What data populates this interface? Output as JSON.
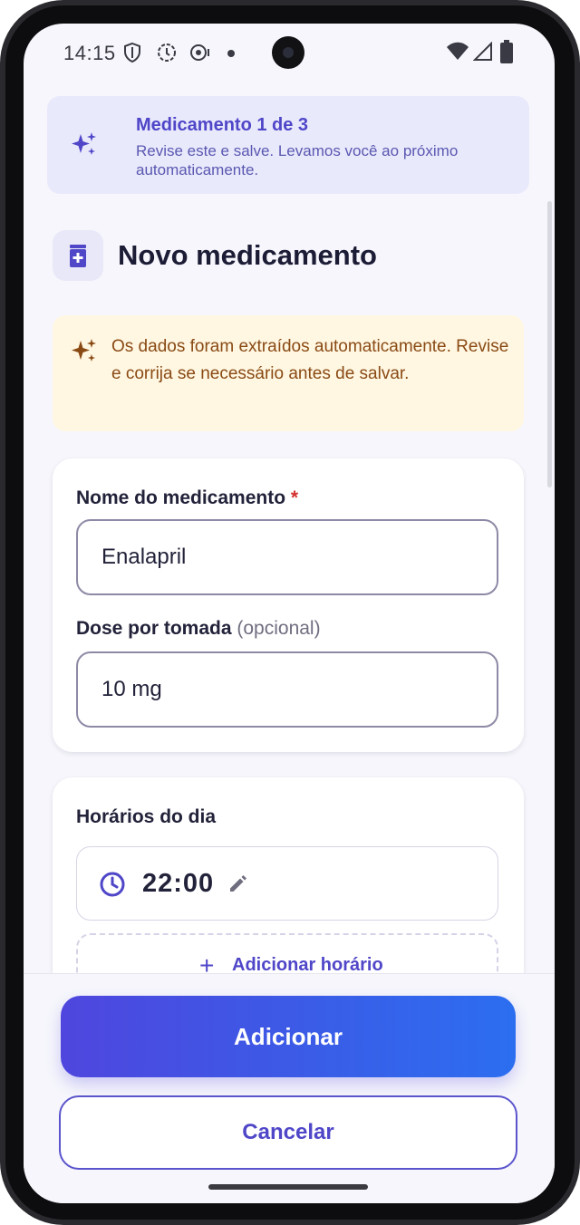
{
  "status_bar": {
    "time": "14:15",
    "icons": [
      "shield-icon",
      "sync-icon",
      "cast-icon",
      "dot-icon",
      "wifi-icon",
      "signal-icon",
      "battery-icon"
    ]
  },
  "banner": {
    "title": "Medicamento 1 de 3",
    "text": "Revise este e salve. Levamos você ao próximo automaticamente.",
    "icon": "sparkle-icon"
  },
  "header": {
    "title": "Novo medicamento",
    "icon": "medicine-bottle-icon"
  },
  "notice": {
    "text": "Os dados foram extraídos automaticamente. Revise e corrija se necessário antes de salvar.",
    "icon": "sparkle-icon"
  },
  "form": {
    "name_label": "Nome do medicamento",
    "required_marker": "*",
    "name_value": "Enalapril",
    "dose_label": "Dose por tomada",
    "dose_optional": "(opcional)",
    "dose_value": "10 mg"
  },
  "schedule": {
    "title": "Horários do dia",
    "times": [
      "22:00"
    ],
    "add_label": "Adicionar horário",
    "add_symbol": "+"
  },
  "actions": {
    "primary_label": "Adicionar",
    "secondary_label": "Cancelar"
  },
  "colors": {
    "accent": "#4f46c8",
    "notice_bg": "#fff7e2",
    "notice_text": "#8a4a14",
    "required": "#d32f2f"
  }
}
